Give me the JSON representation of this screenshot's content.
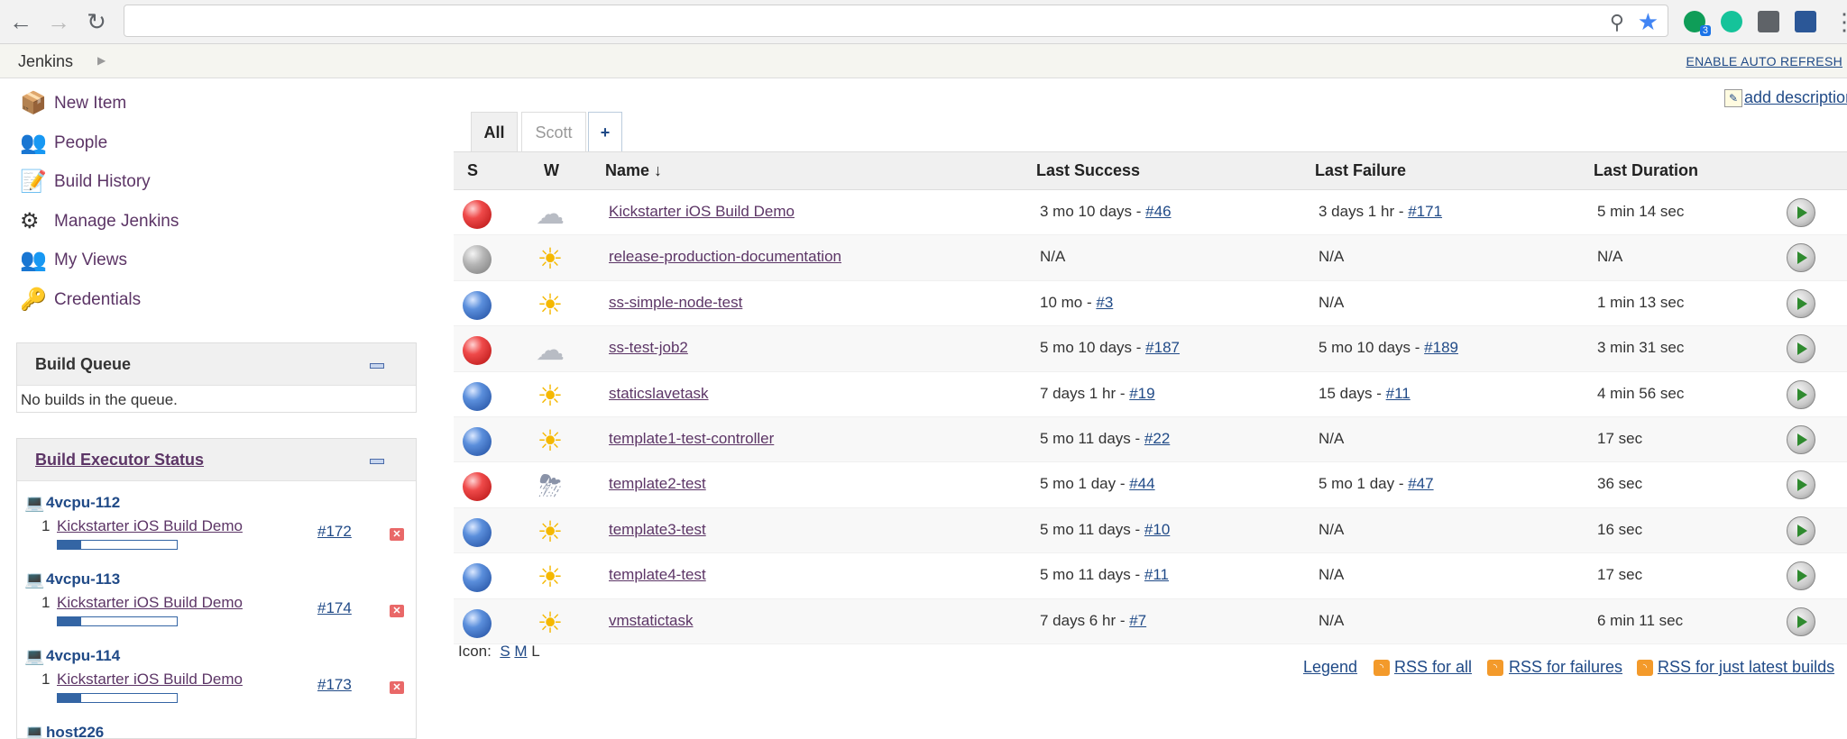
{
  "browser": {
    "address_value": "",
    "extensions": [
      {
        "name": "green-extension-icon",
        "color": "#0f9d58",
        "badge": "3"
      },
      {
        "name": "grammarly-icon",
        "color": "#15c39a"
      },
      {
        "name": "cast-icon",
        "color": "#5f6368"
      },
      {
        "name": "profile-icon",
        "color": "#2b5797"
      }
    ]
  },
  "breadcrumb": {
    "root": "Jenkins",
    "auto_refresh": "ENABLE AUTO REFRESH"
  },
  "tasks": [
    {
      "label": "New Item",
      "icon": "new-item-icon",
      "glyph": "📦"
    },
    {
      "label": "People",
      "icon": "people-icon",
      "glyph": "👥"
    },
    {
      "label": "Build History",
      "icon": "notepad-icon",
      "glyph": "📝"
    },
    {
      "label": "Manage Jenkins",
      "icon": "gear-icon",
      "glyph": "⚙"
    },
    {
      "label": "My Views",
      "icon": "my-views-icon",
      "glyph": "👥"
    },
    {
      "label": "Credentials",
      "icon": "keys-icon",
      "glyph": "🔑"
    }
  ],
  "build_queue": {
    "title": "Build Queue",
    "empty_text": "No builds in the queue."
  },
  "executor_status": {
    "title": "Build Executor Status",
    "hosts": [
      {
        "name": "4vcpu-112",
        "executors": [
          {
            "num": "1",
            "job": "Kickstarter iOS Build Demo",
            "build": "#172",
            "progress": 0.2
          }
        ]
      },
      {
        "name": "4vcpu-113",
        "executors": [
          {
            "num": "1",
            "job": "Kickstarter iOS Build Demo",
            "build": "#174",
            "progress": 0.2
          }
        ]
      },
      {
        "name": "4vcpu-114",
        "executors": [
          {
            "num": "1",
            "job": "Kickstarter iOS Build Demo",
            "build": "#173",
            "progress": 0.2
          }
        ]
      },
      {
        "name": "host226",
        "executors": []
      }
    ]
  },
  "add_description": "add description",
  "views": {
    "tabs": [
      "All",
      "Scott"
    ],
    "add_tab": "+"
  },
  "table": {
    "headers": {
      "s": "S",
      "w": "W",
      "name": "Name",
      "sort_arrow": "↓",
      "last_success": "Last Success",
      "last_failure": "Last Failure",
      "last_duration": "Last Duration"
    },
    "rows": [
      {
        "status": "red",
        "weather": "cloud",
        "name": "Kickstarter iOS Build Demo",
        "success_time": "3 mo 10 days - ",
        "success_build": "#46",
        "failure_time": "3 days 1 hr - ",
        "failure_build": "#171",
        "duration": "5 min 14 sec"
      },
      {
        "status": "grey",
        "weather": "sun",
        "name": "release-production-documentation",
        "success_time": "N/A",
        "success_build": "",
        "failure_time": "N/A",
        "failure_build": "",
        "duration": "N/A"
      },
      {
        "status": "blue",
        "weather": "sun",
        "name": "ss-simple-node-test",
        "success_time": "10 mo - ",
        "success_build": "#3",
        "failure_time": "N/A",
        "failure_build": "",
        "duration": "1 min 13 sec"
      },
      {
        "status": "red",
        "weather": "cloud",
        "name": "ss-test-job2",
        "success_time": "5 mo 10 days - ",
        "success_build": "#187",
        "failure_time": "5 mo 10 days - ",
        "failure_build": "#189",
        "duration": "3 min 31 sec"
      },
      {
        "status": "blue",
        "weather": "sun",
        "name": "staticslavetask",
        "success_time": "7 days 1 hr - ",
        "success_build": "#19",
        "failure_time": "15 days - ",
        "failure_build": "#11",
        "duration": "4 min 56 sec"
      },
      {
        "status": "blue",
        "weather": "sun",
        "name": "template1-test-controller",
        "success_time": "5 mo 11 days - ",
        "success_build": "#22",
        "failure_time": "N/A",
        "failure_build": "",
        "duration": "17 sec"
      },
      {
        "status": "red",
        "weather": "storm",
        "name": "template2-test",
        "success_time": "5 mo 1 day - ",
        "success_build": "#44",
        "failure_time": "5 mo 1 day - ",
        "failure_build": "#47",
        "duration": "36 sec"
      },
      {
        "status": "blue",
        "weather": "sun",
        "name": "template3-test",
        "success_time": "5 mo 11 days - ",
        "success_build": "#10",
        "failure_time": "N/A",
        "failure_build": "",
        "duration": "16 sec"
      },
      {
        "status": "blue",
        "weather": "sun",
        "name": "template4-test",
        "success_time": "5 mo 11 days - ",
        "success_build": "#11",
        "failure_time": "N/A",
        "failure_build": "",
        "duration": "17 sec"
      },
      {
        "status": "blue",
        "weather": "sun",
        "name": "vmstatictask",
        "success_time": "7 days 6 hr - ",
        "success_build": "#7",
        "failure_time": "N/A",
        "failure_build": "",
        "duration": "6 min 11 sec"
      }
    ]
  },
  "icon_size": {
    "label": "Icon:",
    "options": [
      "S",
      "M",
      "L"
    ]
  },
  "footer": {
    "legend": "Legend",
    "rss_all": "RSS for all",
    "rss_failures": "RSS for failures",
    "rss_latest": "RSS for just latest builds"
  }
}
